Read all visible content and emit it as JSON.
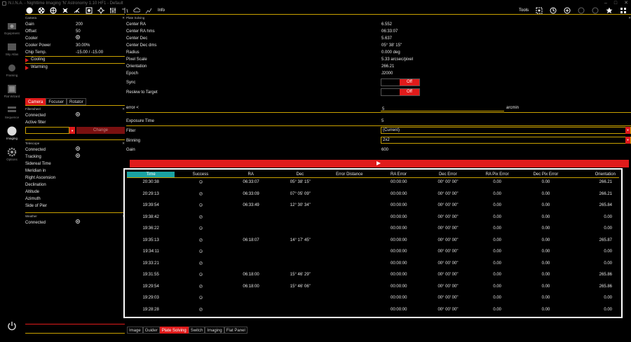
{
  "window": {
    "title": "N.I.N.A. - Nighttime Imaging 'N' Astronomy 1.10 HF1  -  Default"
  },
  "nav": [
    {
      "label": "Equipment",
      "icon": "camera-icon"
    },
    {
      "label": "Sky Atlas",
      "icon": "map-icon"
    },
    {
      "label": "Framing",
      "icon": "framing-icon"
    },
    {
      "label": "Flat Wizard",
      "icon": "flat-wizard-icon"
    },
    {
      "label": "Sequence",
      "icon": "sequence-icon"
    },
    {
      "label": "Imaging",
      "icon": "imaging-icon"
    },
    {
      "label": "Options",
      "icon": "gear-icon"
    }
  ],
  "toolbar": {
    "info_label": "Info",
    "tools_label": "Tools"
  },
  "camera": {
    "title": "Camera",
    "rows": [
      {
        "k": "Gain",
        "v": "200"
      },
      {
        "k": "Offset",
        "v": "50"
      },
      {
        "k": "Cooler",
        "v": ""
      },
      {
        "k": "Cooler Power",
        "v": "30.00%"
      },
      {
        "k": "Chip Temp.",
        "v": "-15.00 /  -15.00"
      }
    ],
    "cooling_label": "Cooling",
    "warming_label": "Warming"
  },
  "subtabs": [
    "Camera",
    "Focuser",
    "Rotator"
  ],
  "filterwheel": {
    "title": "Filterwheel",
    "connected_label": "Connected",
    "active_filter_label": "Active filter",
    "change_label": "Change"
  },
  "telescope": {
    "title": "Telescope",
    "rows": [
      "Connected",
      "Tracking",
      "Sidereal Time",
      "Meridian in",
      "Right Ascension",
      "Declination",
      "Altitude",
      "Azimuth",
      "Side of Pier"
    ]
  },
  "weather": {
    "title": "Weather",
    "connected_label": "Connected"
  },
  "plate_solving": {
    "title": "Plate Solving",
    "rows": [
      {
        "k": "Center RA",
        "v": "6.552"
      },
      {
        "k": "Center RA hms",
        "v": "06:33:07"
      },
      {
        "k": "Center Dec",
        "v": "5.637"
      },
      {
        "k": "Center Dec dms",
        "v": "05° 38' 15\""
      },
      {
        "k": "Radius",
        "v": "0.000 deg"
      },
      {
        "k": "Pixel Scale",
        "v": "5.33 arcsec/pixel"
      },
      {
        "k": "Orientation",
        "v": "266.21"
      },
      {
        "k": "Epoch",
        "v": "J2000"
      }
    ],
    "sync_label": "Sync",
    "sync_value": "Off",
    "reslew_label": "Reslew to Target",
    "reslew_value": "Off",
    "error_label": "error <",
    "error_value": "5",
    "error_unit": "arcmin",
    "exposure_label": "Exposure Time",
    "exposure_value": "5",
    "filter_label": "Filter",
    "filter_value": "(Current)",
    "binning_label": "Binning",
    "binning_value": "2x2",
    "gain_label": "Gain",
    "gain_value": "600"
  },
  "table": {
    "headers": [
      "Time",
      "Success",
      "RA",
      "Dec",
      "Error Distance",
      "RA Error",
      "Dec Error",
      "RA Pix Error",
      "Dec Pix Error",
      "Orientation"
    ],
    "rows": [
      {
        "time": "20:30:38",
        "ra": "06:33:07",
        "dec": "05° 38' 15\"",
        "dist": "",
        "ra_err": "00:00:00",
        "dec_err": "00° 00' 00\"",
        "ra_pix": "0.00",
        "dec_pix": "0.00",
        "ori": "266.21"
      },
      {
        "time": "20:29:13",
        "ra": "06:33:09",
        "dec": "07° 05' 09\"",
        "dist": "",
        "ra_err": "00:00:00",
        "dec_err": "00° 00' 00\"",
        "ra_pix": "0.00",
        "dec_pix": "0.00",
        "ori": "266.21"
      },
      {
        "time": "19:39:54",
        "ra": "06:33:49",
        "dec": "12° 30' 34\"",
        "dist": "",
        "ra_err": "00:00:00",
        "dec_err": "00° 00' 00\"",
        "ra_pix": "0.00",
        "dec_pix": "0.00",
        "ori": "265.84"
      },
      {
        "time": "19:38:42",
        "ra": "",
        "dec": "",
        "dist": "",
        "ra_err": "00:00:00",
        "dec_err": "00° 00' 00\"",
        "ra_pix": "0.00",
        "dec_pix": "0.00",
        "ori": "0.00"
      },
      {
        "time": "19:36:22",
        "ra": "",
        "dec": "",
        "dist": "",
        "ra_err": "00:00:00",
        "dec_err": "00° 00' 00\"",
        "ra_pix": "0.00",
        "dec_pix": "0.00",
        "ori": "0.00"
      },
      {
        "time": "19:35:13",
        "ra": "06:18:07",
        "dec": "14° 17' 45\"",
        "dist": "",
        "ra_err": "00:00:00",
        "dec_err": "00° 00' 00\"",
        "ra_pix": "0.00",
        "dec_pix": "0.00",
        "ori": "265.87"
      },
      {
        "time": "19:34:11",
        "ra": "",
        "dec": "",
        "dist": "",
        "ra_err": "00:00:00",
        "dec_err": "00° 00' 00\"",
        "ra_pix": "0.00",
        "dec_pix": "0.00",
        "ori": "0.00"
      },
      {
        "time": "19:33:21",
        "ra": "",
        "dec": "",
        "dist": "",
        "ra_err": "00:00:00",
        "dec_err": "00° 00' 00\"",
        "ra_pix": "0.00",
        "dec_pix": "0.00",
        "ori": "0.00"
      },
      {
        "time": "19:31:55",
        "ra": "06:18:00",
        "dec": "15° 46' 29\"",
        "dist": "",
        "ra_err": "00:00:00",
        "dec_err": "00° 00' 00\"",
        "ra_pix": "0.00",
        "dec_pix": "0.00",
        "ori": "265.86"
      },
      {
        "time": "19:29:54",
        "ra": "06:18:00",
        "dec": "15° 46' 06\"",
        "dist": "",
        "ra_err": "00:00:00",
        "dec_err": "00° 00' 00\"",
        "ra_pix": "0.00",
        "dec_pix": "0.00",
        "ori": "265.86"
      },
      {
        "time": "19:29:03",
        "ra": "",
        "dec": "",
        "dist": "",
        "ra_err": "00:00:00",
        "dec_err": "00° 00' 00\"",
        "ra_pix": "0.00",
        "dec_pix": "0.00",
        "ori": "0.00"
      },
      {
        "time": "19:28:28",
        "ra": "",
        "dec": "",
        "dist": "",
        "ra_err": "00:00:00",
        "dec_err": "00° 00' 00\"",
        "ra_pix": "0.00",
        "dec_pix": "0.00",
        "ori": "0.00"
      }
    ]
  },
  "bottom_tabs": [
    "Image",
    "Guider",
    "Plate Solving",
    "Switch",
    "Imaging",
    "Flat Panel"
  ],
  "colors": {
    "accent": "#e01b1b",
    "divider": "#c8a000",
    "active_header": "#1aa3a3"
  }
}
